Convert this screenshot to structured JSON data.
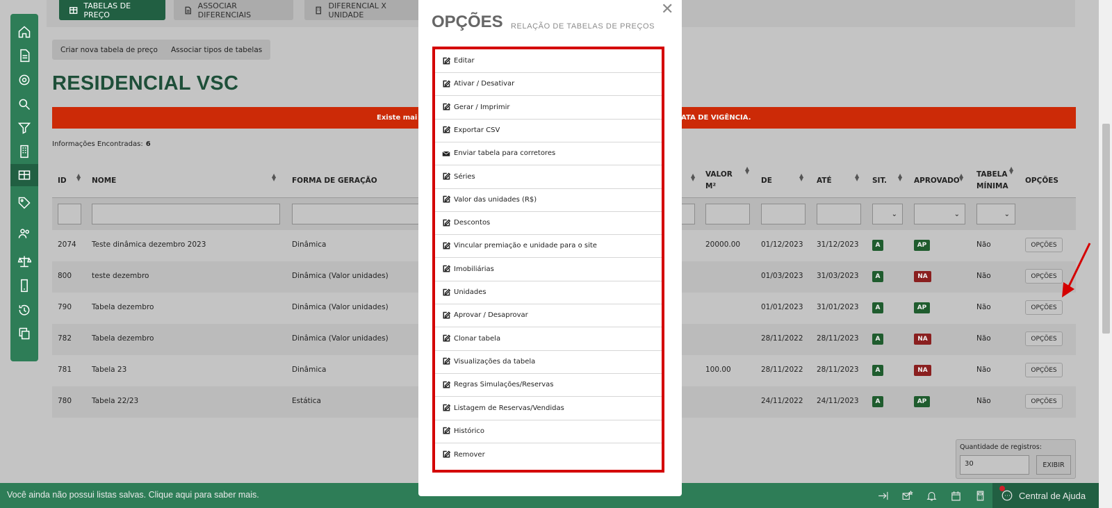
{
  "top_tabs": [
    "TABELAS DE PREÇO",
    "ASSOCIAR DIFERENCIAIS",
    "DIFERENCIAL X UNIDADE"
  ],
  "actions": {
    "create": "Criar nova tabela de preço",
    "associate": "Associar tipos de tabelas"
  },
  "page_title": "RESIDENCIAL VSC",
  "alert": {
    "left": "Existe mai",
    "right": "ATA DE VIGÊNCIA."
  },
  "info": {
    "label": "Informações Encontradas:",
    "count": "6"
  },
  "columns": {
    "id": "ID",
    "nome": "NOME",
    "forma": "FORMA DE GERAÇÃO",
    "valor1": "VALOR",
    "valor2": "M²",
    "de": "DE",
    "ate": "ATÉ",
    "sit": "SIT.",
    "aprovado": "APROVADO",
    "tabela1": "TABELA",
    "tabela2": "MÍNIMA",
    "opcoes": "OPÇÕES"
  },
  "rows": [
    {
      "id": "2074",
      "nome": "Teste dinâmica dezembro 2023",
      "forma": "Dinâmica",
      "valor": "20000.00",
      "de": "01/12/2023",
      "ate": "31/12/2023",
      "sit": "A",
      "aprovado": "AP",
      "minima": "Não",
      "opcoes": "OPÇÕES"
    },
    {
      "id": "800",
      "nome": "teste dezembro",
      "forma": "Dinâmica (Valor unidades)",
      "valor": "",
      "de": "01/03/2023",
      "ate": "31/03/2023",
      "sit": "A",
      "aprovado": "NA",
      "minima": "Não",
      "opcoes": "OPÇÕES"
    },
    {
      "id": "790",
      "nome": "Tabela dezembro",
      "forma": "Dinâmica (Valor unidades)",
      "valor": "",
      "de": "01/01/2023",
      "ate": "31/01/2023",
      "sit": "A",
      "aprovado": "AP",
      "minima": "Não",
      "opcoes": "OPÇÕES"
    },
    {
      "id": "782",
      "nome": "Tabela dezembro",
      "forma": "Dinâmica (Valor unidades)",
      "valor": "",
      "de": "28/11/2022",
      "ate": "28/11/2023",
      "sit": "A",
      "aprovado": "NA",
      "minima": "Não",
      "opcoes": "OPÇÕES"
    },
    {
      "id": "781",
      "nome": "Tabela 23",
      "forma": "Dinâmica",
      "valor": "100.00",
      "de": "28/11/2022",
      "ate": "28/11/2023",
      "sit": "A",
      "aprovado": "NA",
      "minima": "Não",
      "opcoes": "OPÇÕES"
    },
    {
      "id": "780",
      "nome": "Tabela 22/23",
      "forma": "Estática",
      "valor": "",
      "de": "24/11/2022",
      "ate": "24/11/2023",
      "sit": "A",
      "aprovado": "AP",
      "minima": "Não",
      "opcoes": "OPÇÕES"
    }
  ],
  "pagination": {
    "label": "Quantidade de registros:",
    "value": "30",
    "button": "EXIBIR"
  },
  "footer": {
    "message": "Você ainda não possui listas salvas. Clique aqui para saber mais.",
    "help": "Central de Ajuda"
  },
  "modal": {
    "title": "OPÇÕES",
    "subtitle": "RELAÇÃO DE TABELAS DE PREÇOS",
    "items": [
      {
        "label": "Editar",
        "icon": "edit-icon"
      },
      {
        "label": "Ativar / Desativar",
        "icon": "edit-icon"
      },
      {
        "label": "Gerar / Imprimir",
        "icon": "edit-icon"
      },
      {
        "label": "Exportar CSV",
        "icon": "edit-icon"
      },
      {
        "label": "Enviar tabela para corretores",
        "icon": "envelope-icon"
      },
      {
        "label": "Séries",
        "icon": "edit-icon"
      },
      {
        "label": "Valor das unidades (R$)",
        "icon": "edit-icon"
      },
      {
        "label": "Descontos",
        "icon": "edit-icon"
      },
      {
        "label": "Vincular premiação e unidade para o site",
        "icon": "edit-icon"
      },
      {
        "label": "Imobiliárias",
        "icon": "edit-icon"
      },
      {
        "label": "Unidades",
        "icon": "edit-icon"
      },
      {
        "label": "Aprovar / Desaprovar",
        "icon": "edit-icon"
      },
      {
        "label": "Clonar tabela",
        "icon": "edit-icon"
      },
      {
        "label": "Visualizações da tabela",
        "icon": "edit-icon"
      },
      {
        "label": "Regras Simulações/Reservas",
        "icon": "edit-icon"
      },
      {
        "label": "Listagem de Reservas/Vendidas",
        "icon": "edit-icon"
      },
      {
        "label": "Histórico",
        "icon": "edit-icon"
      },
      {
        "label": "Remover",
        "icon": "edit-icon"
      }
    ]
  },
  "colors": {
    "brand": "#2e7d57",
    "alert": "#cc2a07",
    "highlight": "#d40000"
  }
}
